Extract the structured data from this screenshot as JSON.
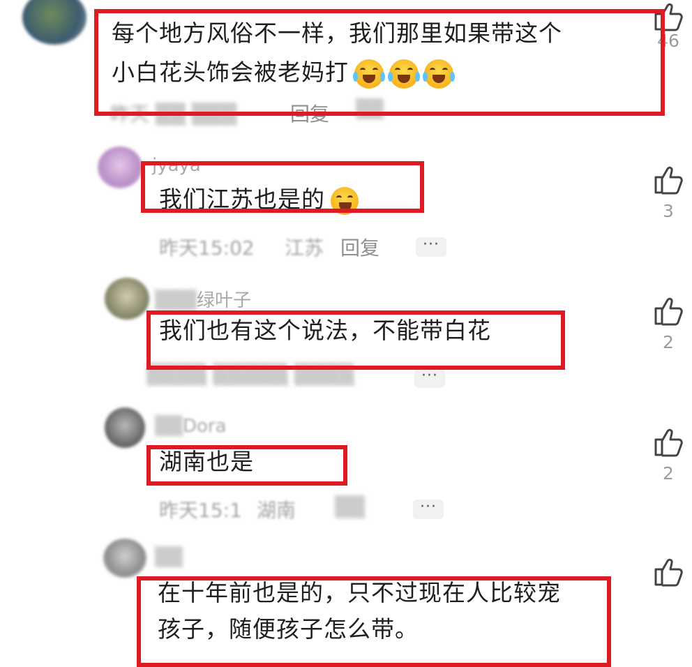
{
  "comments": [
    {
      "username": "",
      "text_lines": [
        "每个地方风俗不一样，我们那里如果带这个",
        "小白花头饰会被老妈打"
      ],
      "emojis": [
        "crying-laughing-emoji",
        "crying-laughing-emoji",
        "crying-laughing-emoji"
      ],
      "meta": "昨天",
      "reply_label": "回复",
      "likes": "46"
    },
    {
      "username": "jyaya",
      "text_lines": [
        "我们江苏也是的"
      ],
      "emojis": [
        "laughing-emoji"
      ],
      "meta": "昨天15:02",
      "location": "江苏",
      "reply_label": "回复",
      "more_label": "···",
      "likes": "3"
    },
    {
      "username": "绿叶子",
      "text_lines": [
        "我们也有这个说法，不能带白花"
      ],
      "more_label": "···",
      "likes": "2"
    },
    {
      "username": "Dora",
      "text_lines": [
        "湖南也是"
      ],
      "meta": "昨天15:1",
      "location": "湖南",
      "more_label": "···",
      "likes": "2"
    },
    {
      "username": "",
      "text_lines": [
        "在十年前也是的，只不过现在人比较宠",
        "孩子，随便孩子怎么带。"
      ],
      "likes": ""
    }
  ],
  "colors": {
    "highlight": "#e01a22",
    "meta": "#a3a3a3",
    "text": "#1f1f1f"
  }
}
